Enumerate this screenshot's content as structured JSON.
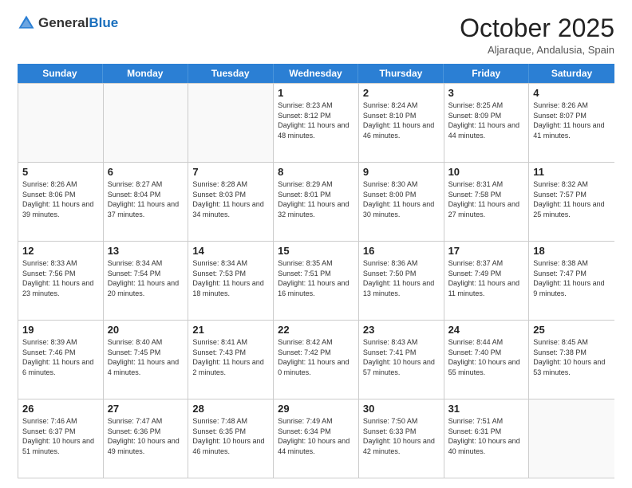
{
  "header": {
    "logo_general": "General",
    "logo_blue": "Blue",
    "month": "October 2025",
    "location": "Aljaraque, Andalusia, Spain"
  },
  "days_of_week": [
    "Sunday",
    "Monday",
    "Tuesday",
    "Wednesday",
    "Thursday",
    "Friday",
    "Saturday"
  ],
  "weeks": [
    [
      {
        "day": "",
        "info": ""
      },
      {
        "day": "",
        "info": ""
      },
      {
        "day": "",
        "info": ""
      },
      {
        "day": "1",
        "info": "Sunrise: 8:23 AM\nSunset: 8:12 PM\nDaylight: 11 hours and 48 minutes."
      },
      {
        "day": "2",
        "info": "Sunrise: 8:24 AM\nSunset: 8:10 PM\nDaylight: 11 hours and 46 minutes."
      },
      {
        "day": "3",
        "info": "Sunrise: 8:25 AM\nSunset: 8:09 PM\nDaylight: 11 hours and 44 minutes."
      },
      {
        "day": "4",
        "info": "Sunrise: 8:26 AM\nSunset: 8:07 PM\nDaylight: 11 hours and 41 minutes."
      }
    ],
    [
      {
        "day": "5",
        "info": "Sunrise: 8:26 AM\nSunset: 8:06 PM\nDaylight: 11 hours and 39 minutes."
      },
      {
        "day": "6",
        "info": "Sunrise: 8:27 AM\nSunset: 8:04 PM\nDaylight: 11 hours and 37 minutes."
      },
      {
        "day": "7",
        "info": "Sunrise: 8:28 AM\nSunset: 8:03 PM\nDaylight: 11 hours and 34 minutes."
      },
      {
        "day": "8",
        "info": "Sunrise: 8:29 AM\nSunset: 8:01 PM\nDaylight: 11 hours and 32 minutes."
      },
      {
        "day": "9",
        "info": "Sunrise: 8:30 AM\nSunset: 8:00 PM\nDaylight: 11 hours and 30 minutes."
      },
      {
        "day": "10",
        "info": "Sunrise: 8:31 AM\nSunset: 7:58 PM\nDaylight: 11 hours and 27 minutes."
      },
      {
        "day": "11",
        "info": "Sunrise: 8:32 AM\nSunset: 7:57 PM\nDaylight: 11 hours and 25 minutes."
      }
    ],
    [
      {
        "day": "12",
        "info": "Sunrise: 8:33 AM\nSunset: 7:56 PM\nDaylight: 11 hours and 23 minutes."
      },
      {
        "day": "13",
        "info": "Sunrise: 8:34 AM\nSunset: 7:54 PM\nDaylight: 11 hours and 20 minutes."
      },
      {
        "day": "14",
        "info": "Sunrise: 8:34 AM\nSunset: 7:53 PM\nDaylight: 11 hours and 18 minutes."
      },
      {
        "day": "15",
        "info": "Sunrise: 8:35 AM\nSunset: 7:51 PM\nDaylight: 11 hours and 16 minutes."
      },
      {
        "day": "16",
        "info": "Sunrise: 8:36 AM\nSunset: 7:50 PM\nDaylight: 11 hours and 13 minutes."
      },
      {
        "day": "17",
        "info": "Sunrise: 8:37 AM\nSunset: 7:49 PM\nDaylight: 11 hours and 11 minutes."
      },
      {
        "day": "18",
        "info": "Sunrise: 8:38 AM\nSunset: 7:47 PM\nDaylight: 11 hours and 9 minutes."
      }
    ],
    [
      {
        "day": "19",
        "info": "Sunrise: 8:39 AM\nSunset: 7:46 PM\nDaylight: 11 hours and 6 minutes."
      },
      {
        "day": "20",
        "info": "Sunrise: 8:40 AM\nSunset: 7:45 PM\nDaylight: 11 hours and 4 minutes."
      },
      {
        "day": "21",
        "info": "Sunrise: 8:41 AM\nSunset: 7:43 PM\nDaylight: 11 hours and 2 minutes."
      },
      {
        "day": "22",
        "info": "Sunrise: 8:42 AM\nSunset: 7:42 PM\nDaylight: 11 hours and 0 minutes."
      },
      {
        "day": "23",
        "info": "Sunrise: 8:43 AM\nSunset: 7:41 PM\nDaylight: 10 hours and 57 minutes."
      },
      {
        "day": "24",
        "info": "Sunrise: 8:44 AM\nSunset: 7:40 PM\nDaylight: 10 hours and 55 minutes."
      },
      {
        "day": "25",
        "info": "Sunrise: 8:45 AM\nSunset: 7:38 PM\nDaylight: 10 hours and 53 minutes."
      }
    ],
    [
      {
        "day": "26",
        "info": "Sunrise: 7:46 AM\nSunset: 6:37 PM\nDaylight: 10 hours and 51 minutes."
      },
      {
        "day": "27",
        "info": "Sunrise: 7:47 AM\nSunset: 6:36 PM\nDaylight: 10 hours and 49 minutes."
      },
      {
        "day": "28",
        "info": "Sunrise: 7:48 AM\nSunset: 6:35 PM\nDaylight: 10 hours and 46 minutes."
      },
      {
        "day": "29",
        "info": "Sunrise: 7:49 AM\nSunset: 6:34 PM\nDaylight: 10 hours and 44 minutes."
      },
      {
        "day": "30",
        "info": "Sunrise: 7:50 AM\nSunset: 6:33 PM\nDaylight: 10 hours and 42 minutes."
      },
      {
        "day": "31",
        "info": "Sunrise: 7:51 AM\nSunset: 6:31 PM\nDaylight: 10 hours and 40 minutes."
      },
      {
        "day": "",
        "info": ""
      }
    ]
  ]
}
